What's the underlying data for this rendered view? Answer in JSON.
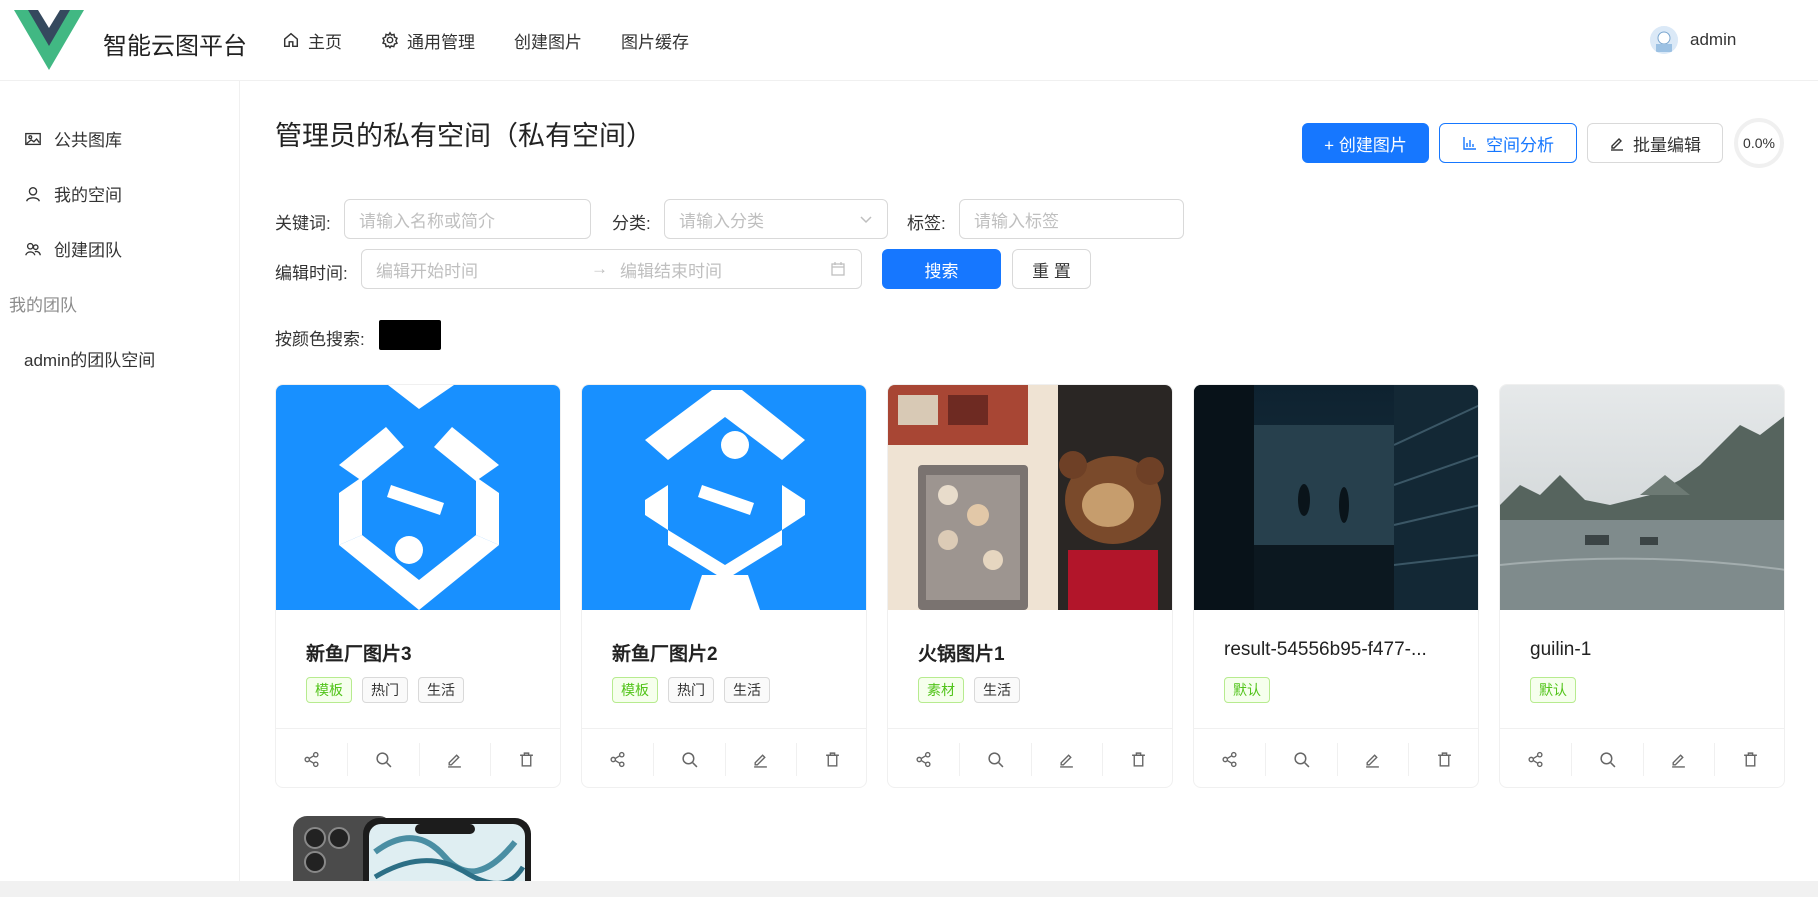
{
  "header": {
    "app_title": "智能云图平台",
    "nav": [
      {
        "label": "主页",
        "icon": "home-icon"
      },
      {
        "label": "通用管理",
        "icon": "gear-icon"
      },
      {
        "label": "创建图片"
      },
      {
        "label": "图片缓存"
      }
    ],
    "user": {
      "name": "admin"
    }
  },
  "sidebar": {
    "items": [
      {
        "label": "公共图库",
        "icon": "image-icon"
      },
      {
        "label": "我的空间",
        "icon": "user-icon"
      },
      {
        "label": "创建团队",
        "icon": "team-icon"
      }
    ],
    "group_label": "我的团队",
    "team_items": [
      {
        "label": "admin的团队空间"
      }
    ]
  },
  "main": {
    "title": "管理员的私有空间（私有空间）",
    "buttons": {
      "create": "+ 创建图片",
      "analyze": "空间分析",
      "batch_edit": "批量编辑"
    },
    "usage_percent": "0.0%",
    "filters": {
      "keyword_label": "关键词:",
      "keyword_placeholder": "请输入名称或简介",
      "category_label": "分类:",
      "category_placeholder": "请输入分类",
      "tag_label": "标签:",
      "tag_placeholder": "请输入标签",
      "edit_time_label": "编辑时间:",
      "start_placeholder": "编辑开始时间",
      "end_placeholder": "编辑结束时间",
      "search_button": "搜索",
      "reset_button": "重 置",
      "color_label": "按颜色搜索:",
      "color_value": "#000000"
    },
    "cards": [
      {
        "title": "新鱼厂图片3",
        "bold": true,
        "image": "fish-logo-blue",
        "tags": [
          {
            "label": "模板",
            "color": "green"
          },
          {
            "label": "热门"
          },
          {
            "label": "生活"
          }
        ]
      },
      {
        "title": "新鱼厂图片2",
        "bold": true,
        "image": "fish-logo-blue",
        "tags": [
          {
            "label": "模板",
            "color": "green"
          },
          {
            "label": "热门"
          },
          {
            "label": "生活"
          }
        ]
      },
      {
        "title": "火锅图片1",
        "bold": true,
        "image": "hotpot-photo",
        "tags": [
          {
            "label": "素材",
            "color": "green"
          },
          {
            "label": "生活"
          }
        ]
      },
      {
        "title": "result-54556b95-f477-...",
        "bold": false,
        "image": "dark-balcony-photo",
        "tags": [
          {
            "label": "默认",
            "color": "green"
          }
        ]
      },
      {
        "title": "guilin-1",
        "bold": false,
        "image": "guilin-river-photo",
        "tags": [
          {
            "label": "默认",
            "color": "green"
          }
        ]
      }
    ]
  }
}
